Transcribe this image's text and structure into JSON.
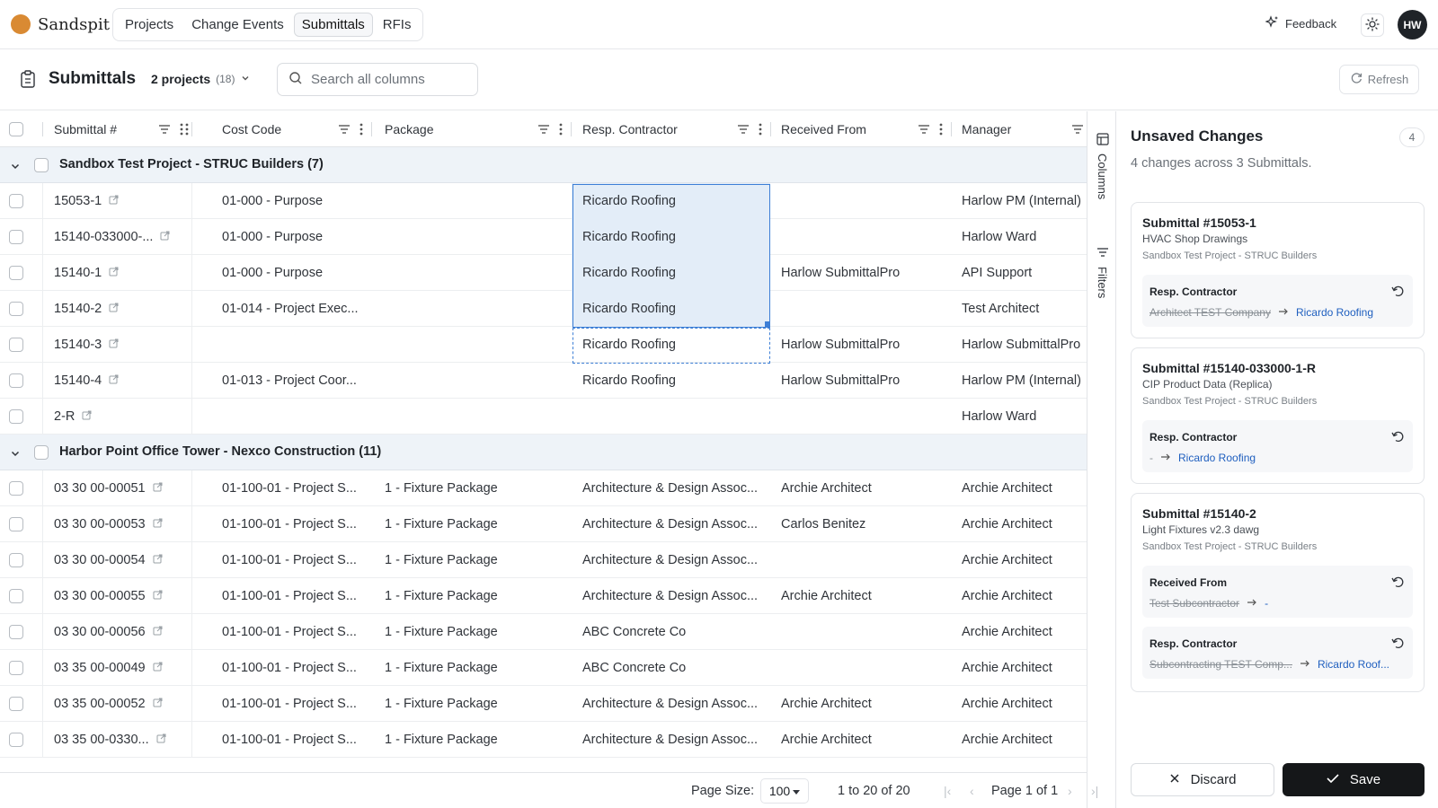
{
  "app": {
    "name": "Sandspit",
    "brand_color": "#d98a33"
  },
  "nav": {
    "tabs": [
      {
        "label": "Projects"
      },
      {
        "label": "Change Events"
      },
      {
        "label": "Submittals",
        "active": true
      },
      {
        "label": "RFIs"
      }
    ]
  },
  "topbar": {
    "feedback_label": "Feedback",
    "avatar_initials": "HW"
  },
  "header": {
    "title": "Submittals",
    "projects_label": "2 projects",
    "projects_count": "(18)",
    "search_placeholder": "Search all columns",
    "refresh_label": "Refresh"
  },
  "columns": [
    "Submittal #",
    "Cost Code",
    "Package",
    "Resp. Contractor",
    "Received From",
    "Manager"
  ],
  "groups": [
    {
      "label": "Sandbox Test Project - STRUC Builders (7)",
      "rows": [
        {
          "num": "15053-1",
          "cost": "01-000 - Purpose",
          "pkg": "",
          "resp": "Ricardo Roofing",
          "recv": "",
          "mgr": "Harlow PM (Internal)"
        },
        {
          "num": "15140-033000-...",
          "cost": "01-000 - Purpose",
          "pkg": "",
          "resp": "Ricardo Roofing",
          "recv": "",
          "mgr": "Harlow Ward"
        },
        {
          "num": "15140-1",
          "cost": "01-000 - Purpose",
          "pkg": "",
          "resp": "Ricardo Roofing",
          "recv": "Harlow SubmittalPro",
          "mgr": "API Support"
        },
        {
          "num": "15140-2",
          "cost": "01-014 - Project Exec...",
          "pkg": "",
          "resp": "Ricardo Roofing",
          "recv": "",
          "mgr": "Test Architect"
        },
        {
          "num": "15140-3",
          "cost": "",
          "pkg": "",
          "resp": "Ricardo Roofing",
          "recv": "Harlow SubmittalPro",
          "mgr": "Harlow SubmittalPro"
        },
        {
          "num": "15140-4",
          "cost": "01-013 - Project Coor...",
          "pkg": "",
          "resp": "Ricardo Roofing",
          "recv": "Harlow SubmittalPro",
          "mgr": "Harlow PM (Internal)"
        },
        {
          "num": "2-R",
          "cost": "",
          "pkg": "",
          "resp": "",
          "recv": "",
          "mgr": "Harlow Ward"
        }
      ]
    },
    {
      "label": "Harbor Point Office Tower - Nexco Construction (11)",
      "rows": [
        {
          "num": "03 30 00-00051",
          "cost": "01-100-01 - Project S...",
          "pkg": "1 - Fixture Package",
          "resp": "Architecture & Design Assoc...",
          "recv": "Archie Architect",
          "mgr": "Archie Architect"
        },
        {
          "num": "03 30 00-00053",
          "cost": "01-100-01 - Project S...",
          "pkg": "1 - Fixture Package",
          "resp": "Architecture & Design Assoc...",
          "recv": "Carlos Benitez",
          "mgr": "Archie Architect"
        },
        {
          "num": "03 30 00-00054",
          "cost": "01-100-01 - Project S...",
          "pkg": "1 - Fixture Package",
          "resp": "Architecture & Design Assoc...",
          "recv": "",
          "mgr": "Archie Architect"
        },
        {
          "num": "03 30 00-00055",
          "cost": "01-100-01 - Project S...",
          "pkg": "1 - Fixture Package",
          "resp": "Architecture & Design Assoc...",
          "recv": "Archie Architect",
          "mgr": "Archie Architect"
        },
        {
          "num": "03 30 00-00056",
          "cost": "01-100-01 - Project S...",
          "pkg": "1 - Fixture Package",
          "resp": "ABC Concrete Co",
          "recv": "",
          "mgr": "Archie Architect"
        },
        {
          "num": "03 35 00-00049",
          "cost": "01-100-01 - Project S...",
          "pkg": "1 - Fixture Package",
          "resp": "ABC Concrete Co",
          "recv": "",
          "mgr": "Archie Architect"
        },
        {
          "num": "03 35 00-00052",
          "cost": "01-100-01 - Project S...",
          "pkg": "1 - Fixture Package",
          "resp": "Architecture & Design Assoc...",
          "recv": "Archie Architect",
          "mgr": "Archie Architect"
        },
        {
          "num": "03 35 00-0330...",
          "cost": "01-100-01 - Project S...",
          "pkg": "1 - Fixture Package",
          "resp": "Architecture & Design Assoc...",
          "recv": "Archie Architect",
          "mgr": "Archie Architect"
        }
      ]
    }
  ],
  "rail": {
    "columns_label": "Columns",
    "filters_label": "Filters"
  },
  "footer": {
    "page_size_label": "Page Size:",
    "page_size_value": "100",
    "range_label": "1 to 20 of 20",
    "page_label": "Page 1 of 1"
  },
  "panel": {
    "title": "Unsaved Changes",
    "badge": "4",
    "subtitle": "4 changes across 3 Submittals.",
    "cards": [
      {
        "title": "Submittal #15053-1",
        "line1": "HVAC Shop Drawings",
        "line2": "Sandbox Test Project - STRUC Builders",
        "changes": [
          {
            "field": "Resp. Contractor",
            "old": "Architect TEST Company",
            "new": "Ricardo Roofing"
          }
        ]
      },
      {
        "title": "Submittal #15140-033000-1-R",
        "line1": "CIP Product Data (Replica)",
        "line2": "Sandbox Test Project - STRUC Builders",
        "changes": [
          {
            "field": "Resp. Contractor",
            "old": "-",
            "new": "Ricardo Roofing",
            "old_plain": true
          }
        ]
      },
      {
        "title": "Submittal #15140-2",
        "line1": "Light Fixtures v2.3 dawg",
        "line2": "Sandbox Test Project - STRUC Builders",
        "changes": [
          {
            "field": "Received From",
            "old": "Test Subcontractor",
            "new": "-"
          },
          {
            "field": "Resp. Contractor",
            "old": "Subcontracting TEST Comp...",
            "new": "Ricardo Roof..."
          }
        ]
      }
    ],
    "discard_label": "Discard",
    "save_label": "Save"
  }
}
